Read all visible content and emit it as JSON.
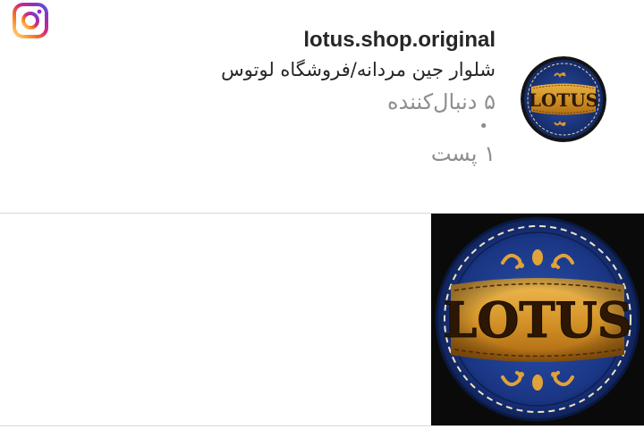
{
  "profile": {
    "username": "lotus.shop.original",
    "full_name": "شلوار جین مردانه/فروشگاه لوتوس",
    "followers_text": "۵ دنبال‌کننده",
    "separator": "•",
    "posts_text": "۱ پست",
    "avatar_icon": "lotus-logo-badge"
  },
  "app": {
    "logo_icon": "instagram-icon"
  },
  "logo_text": "LOTUS",
  "colors": {
    "instagram_gradient": [
      "#feda75",
      "#fa7e1e",
      "#d62976",
      "#962fbf",
      "#4f5bd5"
    ],
    "denim_blue": "#1d3a8a",
    "leather_gold": "#d99a2b",
    "text_secondary": "#8e8e8e"
  }
}
